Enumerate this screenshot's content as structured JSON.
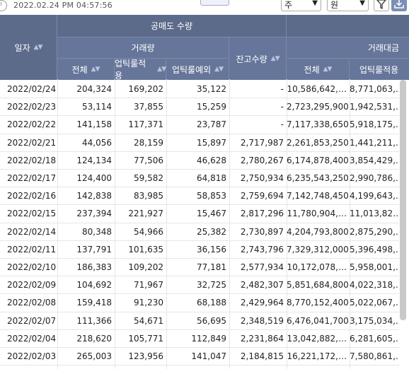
{
  "toolbar": {
    "timestamp": "2022.02.24 PM 04:57:56",
    "period_select": "주",
    "unit_select": "원",
    "filter_icon": "filter-icon",
    "download_icon": "download-icon",
    "clock_icon": "clock-icon"
  },
  "headers": {
    "date": "일자",
    "short_sale_qty": "공매도 수량",
    "volume": "거래량",
    "total": "전체",
    "uptick_applied": "업틱룰적용",
    "uptick_except": "업틱룰예외",
    "balance_qty": "잔고수량",
    "amount": "거래대금",
    "amount_total": "전체",
    "amount_uptick": "업틱룰적용"
  },
  "rows": [
    {
      "date": "2022/02/24",
      "total": "204,324",
      "uptick": "169,202",
      "except": "35,122",
      "balance": "-",
      "amt_total": "10,586,642,…",
      "amt_uptick": "8,771,063,…"
    },
    {
      "date": "2022/02/23",
      "total": "53,114",
      "uptick": "37,855",
      "except": "15,259",
      "balance": "-",
      "amt_total": "2,723,295,900",
      "amt_uptick": "1,942,531,…"
    },
    {
      "date": "2022/02/22",
      "total": "141,158",
      "uptick": "117,371",
      "except": "23,787",
      "balance": "-",
      "amt_total": "7,117,338,650",
      "amt_uptick": "5,918,175,…"
    },
    {
      "date": "2022/02/21",
      "total": "44,056",
      "uptick": "28,159",
      "except": "15,897",
      "balance": "2,717,987",
      "amt_total": "2,261,853,250",
      "amt_uptick": "1,441,211,…"
    },
    {
      "date": "2022/02/18",
      "total": "124,134",
      "uptick": "77,506",
      "except": "46,628",
      "balance": "2,780,267",
      "amt_total": "6,174,878,400",
      "amt_uptick": "3,854,429,…"
    },
    {
      "date": "2022/02/17",
      "total": "124,400",
      "uptick": "59,582",
      "except": "64,818",
      "balance": "2,750,934",
      "amt_total": "6,235,543,250",
      "amt_uptick": "2,990,786,…"
    },
    {
      "date": "2022/02/16",
      "total": "142,838",
      "uptick": "83,985",
      "except": "58,853",
      "balance": "2,759,694",
      "amt_total": "7,142,748,450",
      "amt_uptick": "4,199,643,…"
    },
    {
      "date": "2022/02/15",
      "total": "237,394",
      "uptick": "221,927",
      "except": "15,467",
      "balance": "2,817,296",
      "amt_total": "11,780,904,…",
      "amt_uptick": "11,013,82…"
    },
    {
      "date": "2022/02/14",
      "total": "80,348",
      "uptick": "54,966",
      "except": "25,382",
      "balance": "2,730,897",
      "amt_total": "4,204,793,800",
      "amt_uptick": "2,875,290,…"
    },
    {
      "date": "2022/02/11",
      "total": "137,791",
      "uptick": "101,635",
      "except": "36,156",
      "balance": "2,743,796",
      "amt_total": "7,329,312,000",
      "amt_uptick": "5,396,498,…"
    },
    {
      "date": "2022/02/10",
      "total": "186,383",
      "uptick": "109,202",
      "except": "77,181",
      "balance": "2,577,934",
      "amt_total": "10,172,078,…",
      "amt_uptick": "5,958,001,…"
    },
    {
      "date": "2022/02/09",
      "total": "104,692",
      "uptick": "71,967",
      "except": "32,725",
      "balance": "2,482,307",
      "amt_total": "5,851,684,800",
      "amt_uptick": "4,022,318,…"
    },
    {
      "date": "2022/02/08",
      "total": "159,418",
      "uptick": "91,230",
      "except": "68,188",
      "balance": "2,429,964",
      "amt_total": "8,770,152,400",
      "amt_uptick": "5,022,067,…"
    },
    {
      "date": "2022/02/07",
      "total": "111,366",
      "uptick": "54,671",
      "except": "56,695",
      "balance": "2,348,519",
      "amt_total": "6,476,041,700",
      "amt_uptick": "3,175,034,…"
    },
    {
      "date": "2022/02/04",
      "total": "218,620",
      "uptick": "105,771",
      "except": "112,849",
      "balance": "2,231,864",
      "amt_total": "13,042,882,…",
      "amt_uptick": "6,281,605,…"
    },
    {
      "date": "2022/02/03",
      "total": "265,003",
      "uptick": "123,956",
      "except": "141,047",
      "balance": "2,184,815",
      "amt_total": "16,221,172,…",
      "amt_uptick": "7,580,861,…"
    }
  ]
}
